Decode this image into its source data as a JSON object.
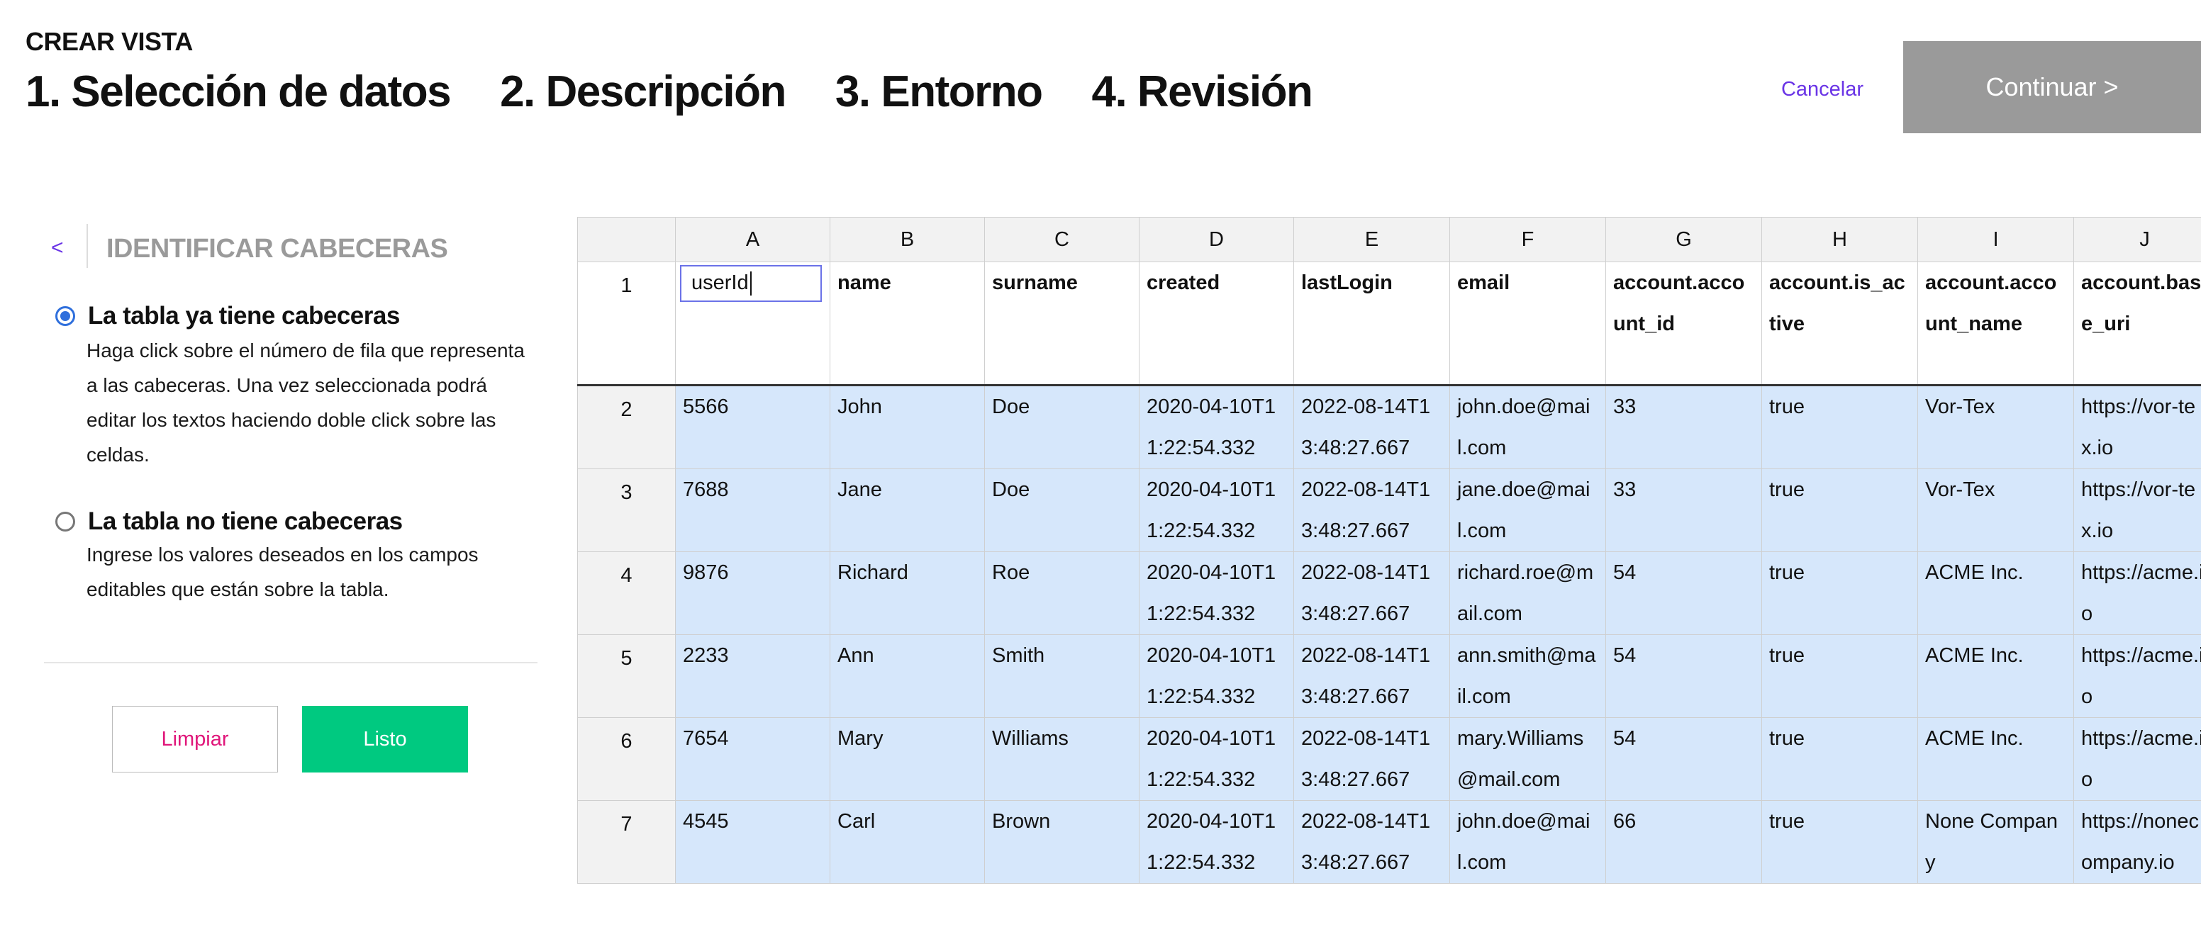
{
  "header": {
    "kicker": "CREAR VISTA",
    "steps": [
      "1. Selección de datos",
      "2. Descripción",
      "3. Entorno",
      "4. Revisión"
    ],
    "cancel_label": "Cancelar",
    "continue_label": "Continuar >"
  },
  "panel": {
    "back_label": "<",
    "title": "IDENTIFICAR CABECERAS",
    "options": [
      {
        "title": "La tabla ya tiene cabeceras",
        "desc": "Haga click sobre el número de fila que representa a las cabeceras. Una vez seleccionada podrá editar los textos haciendo doble click sobre las celdas.",
        "selected": true
      },
      {
        "title": "La tabla no tiene cabeceras",
        "desc": "Ingrese los valores deseados en los campos editables que están sobre la tabla.",
        "selected": false
      }
    ],
    "clear_label": "Limpiar",
    "done_label": "Listo"
  },
  "colors": {
    "accent": "#6a34e6",
    "radio": "#2f6fdc",
    "done": "#00c980",
    "clear_text": "#e0167a",
    "continue_bg": "#9a9a9a",
    "selected_row_bg": "#d6e7fb"
  },
  "grid": {
    "columns": [
      "A",
      "B",
      "C",
      "D",
      "E",
      "F",
      "G",
      "H",
      "I",
      "J"
    ],
    "header_row": {
      "num": "1",
      "cells": [
        "userId",
        "name",
        "surname",
        "created",
        "lastLogin",
        "email",
        "account.account_id",
        "account.is_active",
        "account.account_name",
        "account.base_uri"
      ]
    },
    "rows": [
      {
        "num": "2",
        "cells": [
          "5566",
          "John",
          "Doe",
          "2020-04-10T11:22:54.332",
          "2022-08-14T13:48:27.667",
          "john.doe@mail.com",
          "33",
          "true",
          "Vor-Tex",
          "https://vor-tex.io"
        ]
      },
      {
        "num": "3",
        "cells": [
          "7688",
          "Jane",
          "Doe",
          "2020-04-10T11:22:54.332",
          "2022-08-14T13:48:27.667",
          "jane.doe@mail.com",
          "33",
          "true",
          "Vor-Tex",
          "https://vor-tex.io"
        ]
      },
      {
        "num": "4",
        "cells": [
          "9876",
          "Richard",
          "Roe",
          "2020-04-10T11:22:54.332",
          "2022-08-14T13:48:27.667",
          "richard.roe@mail.com",
          "54",
          "true",
          "ACME Inc.",
          "https://acme.io"
        ]
      },
      {
        "num": "5",
        "cells": [
          "2233",
          "Ann",
          "Smith",
          "2020-04-10T11:22:54.332",
          "2022-08-14T13:48:27.667",
          "ann.smith@mail.com",
          "54",
          "true",
          "ACME Inc.",
          "https://acme.io"
        ]
      },
      {
        "num": "6",
        "cells": [
          "7654",
          "Mary",
          "Williams",
          "2020-04-10T11:22:54.332",
          "2022-08-14T13:48:27.667",
          "mary.Williams@mail.com",
          "54",
          "true",
          "ACME Inc.",
          "https://acme.io"
        ]
      },
      {
        "num": "7",
        "cells": [
          "4545",
          "Carl",
          "Brown",
          "2020-04-10T11:22:54.332",
          "2022-08-14T13:48:27.667",
          "john.doe@mail.com",
          "66",
          "true",
          "None Company",
          "https://nonecompany.io"
        ]
      }
    ]
  }
}
